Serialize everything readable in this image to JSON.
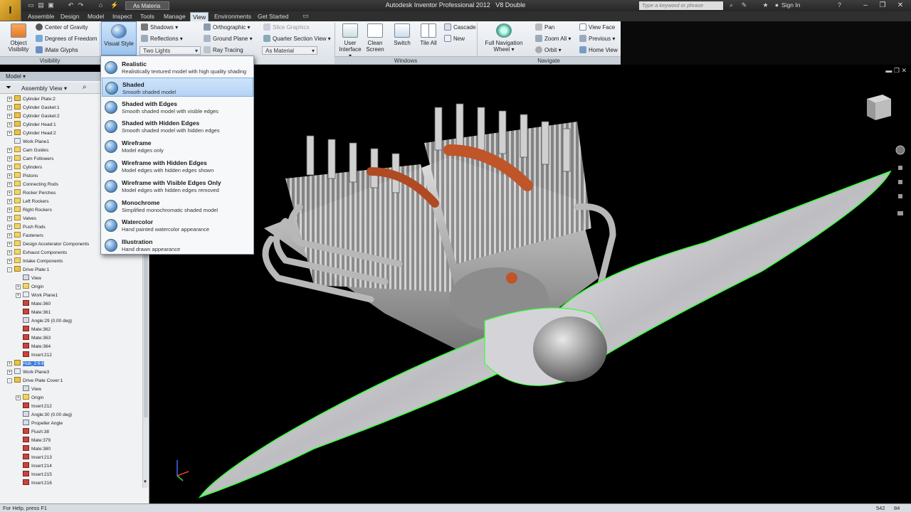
{
  "app": {
    "window_title": "Autodesk Inventor Professional 2012",
    "document_name": "V8 Double",
    "appearance_combo": "As Materia",
    "search_placeholder": "Type a keyword or phrase",
    "sign_in": "Sign In"
  },
  "tabs": [
    "Assemble",
    "Design",
    "Model",
    "Inspect",
    "Tools",
    "Manage",
    "View",
    "Environments",
    "Get Started"
  ],
  "active_tab": "View",
  "ribbon": {
    "visibility": {
      "object_visibility": "Object Visibility",
      "center_of_gravity": "Center of Gravity",
      "degrees_of_freedom": "Degrees of Freedom",
      "imate_glyphs": "iMate Glyphs",
      "panel_label": "Visibility"
    },
    "appearance": {
      "visual_style": "Visual Style",
      "shadows": "Shadows",
      "reflections": "Reflections",
      "lighting": "Two Lights",
      "orthographic": "Orthographic",
      "ground_plane": "Ground Plane",
      "ray_tracing": "Ray Tracing",
      "slice_graphics": "Slice Graphics",
      "quarter_section_view": "Quarter Section View",
      "material": "As Material"
    },
    "windows": {
      "user_interface": "User Interface",
      "clean_screen": "Clean Screen",
      "switch": "Switch",
      "tile_all": "Tile All",
      "cascade": "Cascade",
      "new": "New",
      "panel_label": "Windows"
    },
    "navigate": {
      "full_navigation_wheel": "Full Navigation Wheel",
      "pan": "Pan",
      "zoom_all": "Zoom All",
      "orbit": "Orbit",
      "view_face": "View Face",
      "previous": "Previous",
      "home_view": "Home View",
      "panel_label": "Navigate"
    }
  },
  "visual_style_menu": [
    {
      "title": "Realistic",
      "desc": "Realistically textured model with high quality shading"
    },
    {
      "title": "Shaded",
      "desc": "Smooth shaded model"
    },
    {
      "title": "Shaded with Edges",
      "desc": "Smooth shaded model with visible edges"
    },
    {
      "title": "Shaded with Hidden Edges",
      "desc": "Smooth shaded model with hidden edges"
    },
    {
      "title": "Wireframe",
      "desc": "Model edges only"
    },
    {
      "title": "Wireframe with Hidden Edges",
      "desc": "Model edges with hidden edges shown"
    },
    {
      "title": "Wireframe with Visible Edges Only",
      "desc": "Model edges with hidden edges removed"
    },
    {
      "title": "Monochrome",
      "desc": "Simplified monochromatic shaded model"
    },
    {
      "title": "Watercolor",
      "desc": "Hand painted watercolor appearance"
    },
    {
      "title": "Illustration",
      "desc": "Hand drawn appearance"
    }
  ],
  "browser": {
    "header": "Model",
    "view_mode": "Assembly View",
    "tree": [
      {
        "label": "Cylinder Plate:2",
        "icon": "assembly",
        "indent": 0,
        "exp": "+"
      },
      {
        "label": "Cylinder Gasket:1",
        "icon": "assembly",
        "indent": 0,
        "exp": "+"
      },
      {
        "label": "Cylinder Gasket:2",
        "icon": "assembly",
        "indent": 0,
        "exp": "+"
      },
      {
        "label": "Cylinder Head:1",
        "icon": "assembly",
        "indent": 0,
        "exp": "+"
      },
      {
        "label": "Cylinder Head:2",
        "icon": "assembly",
        "indent": 0,
        "exp": "+"
      },
      {
        "label": "Work Plane1",
        "icon": "plane",
        "indent": 0,
        "exp": ""
      },
      {
        "label": "Cam Guides",
        "icon": "folder",
        "indent": 0,
        "exp": "+"
      },
      {
        "label": "Cam Followers",
        "icon": "folder",
        "indent": 0,
        "exp": "+"
      },
      {
        "label": "Cylinders",
        "icon": "folder",
        "indent": 0,
        "exp": "+"
      },
      {
        "label": "Pistons",
        "icon": "folder",
        "indent": 0,
        "exp": "+"
      },
      {
        "label": "Connecting Rods",
        "icon": "folder",
        "indent": 0,
        "exp": "+"
      },
      {
        "label": "Rocker Perches",
        "icon": "folder",
        "indent": 0,
        "exp": "+"
      },
      {
        "label": "Left Rockers",
        "icon": "folder",
        "indent": 0,
        "exp": "+"
      },
      {
        "label": "Right Rockers",
        "icon": "folder",
        "indent": 0,
        "exp": "+"
      },
      {
        "label": "Valves",
        "icon": "folder",
        "indent": 0,
        "exp": "+"
      },
      {
        "label": "Push Rods",
        "icon": "folder",
        "indent": 0,
        "exp": "+"
      },
      {
        "label": "Fasteners",
        "icon": "folder",
        "indent": 0,
        "exp": "+"
      },
      {
        "label": "Design Accelerator Components",
        "icon": "folder",
        "indent": 0,
        "exp": "+"
      },
      {
        "label": "Exhaust Components",
        "icon": "folder",
        "indent": 0,
        "exp": "+"
      },
      {
        "label": "Intake Components",
        "icon": "folder",
        "indent": 0,
        "exp": "+"
      },
      {
        "label": "Drive Plate:1",
        "icon": "assembly",
        "indent": 0,
        "exp": "-"
      },
      {
        "label": "View",
        "icon": "part",
        "indent": 1,
        "exp": ""
      },
      {
        "label": "Origin",
        "icon": "folder",
        "indent": 1,
        "exp": "+"
      },
      {
        "label": "Work Plane1",
        "icon": "plane",
        "indent": 1,
        "exp": "+"
      },
      {
        "label": "Mate:360",
        "icon": "mate",
        "indent": 1,
        "exp": ""
      },
      {
        "label": "Mate:361",
        "icon": "mate",
        "indent": 1,
        "exp": ""
      },
      {
        "label": "Angle:29 (0.00 deg)",
        "icon": "part",
        "indent": 1,
        "exp": ""
      },
      {
        "label": "Mate:362",
        "icon": "mate",
        "indent": 1,
        "exp": ""
      },
      {
        "label": "Mate:363",
        "icon": "mate",
        "indent": 1,
        "exp": ""
      },
      {
        "label": "Mate:364",
        "icon": "mate",
        "indent": 1,
        "exp": ""
      },
      {
        "label": "Insert:212",
        "icon": "mate",
        "indent": 1,
        "exp": ""
      },
      {
        "label": "Hub_2:6:6",
        "icon": "assembly",
        "indent": 0,
        "exp": "+",
        "selected": true
      },
      {
        "label": "Work Plane3",
        "icon": "plane",
        "indent": 0,
        "exp": "+"
      },
      {
        "label": "Drive Plate Cover:1",
        "icon": "assembly",
        "indent": 0,
        "exp": "-"
      },
      {
        "label": "View",
        "icon": "part",
        "indent": 1,
        "exp": ""
      },
      {
        "label": "Origin",
        "icon": "folder",
        "indent": 1,
        "exp": "+"
      },
      {
        "label": "Insert:212",
        "icon": "mate",
        "indent": 1,
        "exp": ""
      },
      {
        "label": "Angle:30 (0.00 deg)",
        "icon": "part",
        "indent": 1,
        "exp": ""
      },
      {
        "label": "Propeller Angle",
        "icon": "part",
        "indent": 1,
        "exp": ""
      },
      {
        "label": "Flush:38",
        "icon": "mate",
        "indent": 1,
        "exp": ""
      },
      {
        "label": "Mate:379",
        "icon": "mate",
        "indent": 1,
        "exp": ""
      },
      {
        "label": "Mate:380",
        "icon": "mate",
        "indent": 1,
        "exp": ""
      },
      {
        "label": "Insert:213",
        "icon": "mate",
        "indent": 1,
        "exp": ""
      },
      {
        "label": "Insert:214",
        "icon": "mate",
        "indent": 1,
        "exp": ""
      },
      {
        "label": "Insert:215",
        "icon": "mate",
        "indent": 1,
        "exp": ""
      },
      {
        "label": "Insert:216",
        "icon": "mate",
        "indent": 1,
        "exp": ""
      }
    ]
  },
  "status": {
    "help_text": "For Help, press F1",
    "count1": "542",
    "count2": "84"
  },
  "colors": {
    "highlight_edge": "#39ff39",
    "accent_orange": "#c0552a",
    "menu_hover": "#b5d3f4"
  }
}
